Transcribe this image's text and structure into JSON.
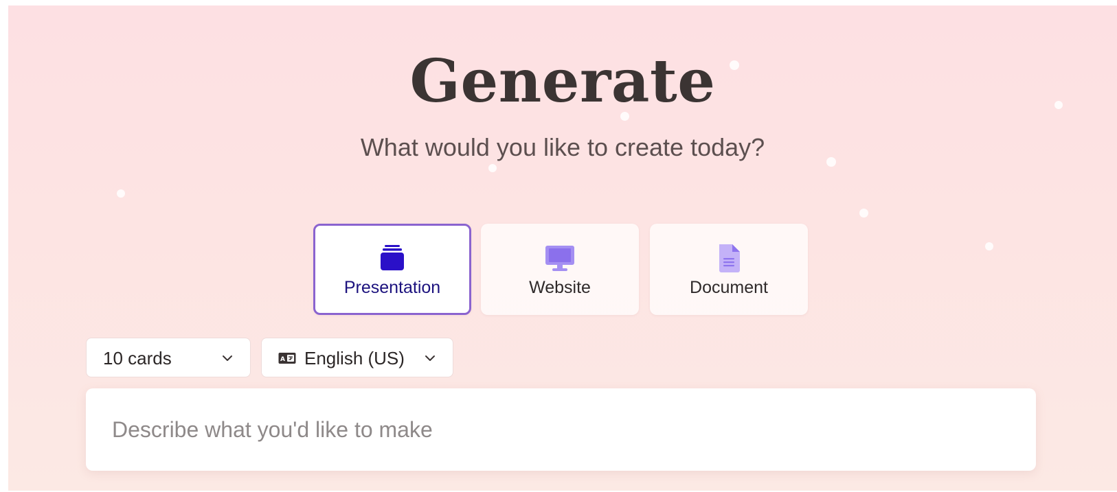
{
  "header": {
    "title": "Generate",
    "subtitle": "What would you like to create today?"
  },
  "content_types": [
    {
      "label": "Presentation",
      "icon": "stack-icon",
      "selected": true
    },
    {
      "label": "Website",
      "icon": "monitor-icon",
      "selected": false
    },
    {
      "label": "Document",
      "icon": "document-icon",
      "selected": false
    }
  ],
  "options": {
    "cards": {
      "value": "10 cards",
      "icon": "chevron-down-icon"
    },
    "language": {
      "value": "English (US)",
      "icon": "language-icon"
    }
  },
  "prompt": {
    "value": "",
    "placeholder": "Describe what you'd like to make"
  },
  "colors": {
    "accent_border": "#8a63cf",
    "selected_text": "#1c127e",
    "presentation_icon": "#2a10c8",
    "icon_light": "#a48ff2",
    "background_top": "#fde0e3",
    "background_bottom": "#fce9e4"
  }
}
